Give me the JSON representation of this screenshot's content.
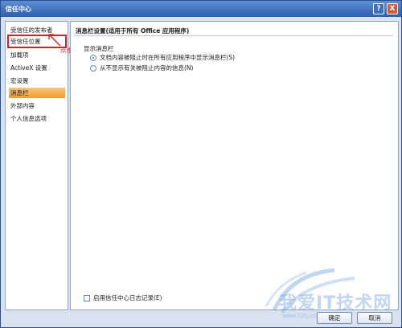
{
  "window": {
    "title": "信任中心"
  },
  "titlebar": {
    "help_glyph": "?",
    "close_glyph": "X"
  },
  "sidebar": {
    "items": [
      {
        "label": "受信任的发布者"
      },
      {
        "label": "受信任位置"
      },
      {
        "label": "加载项"
      },
      {
        "label": "ActiveX 设置"
      },
      {
        "label": "宏设置"
      },
      {
        "label": "消息栏"
      },
      {
        "label": "外部内容"
      },
      {
        "label": "个人信息选项"
      }
    ],
    "selected_index": 5,
    "highlighted_index": 1
  },
  "annotation": {
    "text": "点击这里",
    "color": "#d1222b"
  },
  "main": {
    "header": "消息栏设置(适用于所有 Office 应用程序)",
    "group_label": "显示消息栏",
    "options": [
      {
        "label": "文档内容被阻止时在所有应用程序中显示消息栏(S)",
        "checked": true
      },
      {
        "label": "从不显示有关被阻止内容的信息(N)",
        "checked": false
      }
    ],
    "checkbox_label": "启用信任中心日志记录(E)",
    "checkbox_checked": false
  },
  "footer": {
    "ok_label": "确定",
    "cancel_label": "取消"
  },
  "watermark": {
    "text": "我爱IT技术网",
    "url": "www.52ij.com"
  },
  "colors": {
    "selected_item": "#f29a2e",
    "title_bar": "#2c5fb0",
    "window_bg": "#d9e2ee"
  }
}
